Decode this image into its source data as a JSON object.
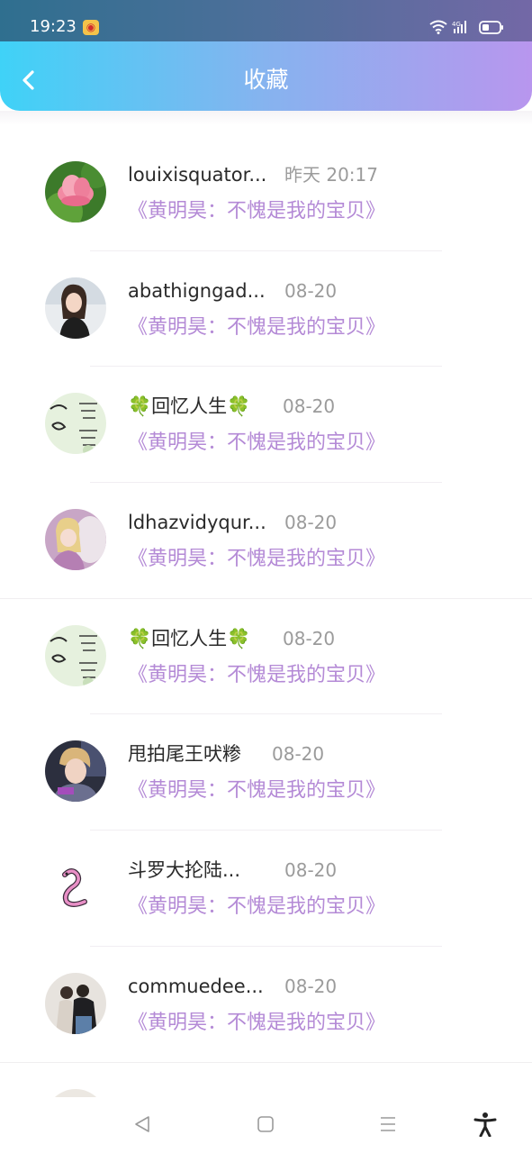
{
  "status_bar": {
    "time": "19:23",
    "app_notification_icon": "weibo-icon",
    "network": "4G"
  },
  "header": {
    "title": "收藏",
    "back_icon": "chevron-left-icon"
  },
  "favorites": [
    {
      "username": "louixisquator...",
      "time": "昨天 20:17",
      "content": "《黄明昊：不愧是我的宝贝》",
      "avatar": "lotus-flower-avatar"
    },
    {
      "username": "abathigngad...",
      "time": "08-20",
      "content": "《黄明昊：不愧是我的宝贝》",
      "avatar": "girl-photo-avatar"
    },
    {
      "username": "🍀回忆人生🍀",
      "time": "08-20",
      "content": "《黄明昊：不愧是我的宝贝》",
      "avatar": "calligraphy-avatar"
    },
    {
      "username": "ldhazvidyqur...",
      "time": "08-20",
      "content": "《黄明昊：不愧是我的宝贝》",
      "avatar": "girl-horse-avatar"
    },
    {
      "username": "🍀回忆人生🍀",
      "time": "08-20",
      "content": "《黄明昊：不愧是我的宝贝》",
      "avatar": "calligraphy-avatar"
    },
    {
      "username": "甩拍尾王吠糁",
      "time": "08-20",
      "content": "《黄明昊：不愧是我的宝贝》",
      "avatar": "boy-photo-avatar"
    },
    {
      "username": "斗罗大抡陆...",
      "time": "08-20",
      "content": "《黄明昊：不愧是我的宝贝》",
      "avatar": "pink-snake-avatar"
    },
    {
      "username": "commuedee...",
      "time": "08-20",
      "content": "《黄明昊：不愧是我的宝贝》",
      "avatar": "group-photo-avatar"
    },
    {
      "username": "",
      "time": "",
      "content": "",
      "avatar": "partial-avatar"
    }
  ],
  "system_nav": {
    "buttons": [
      "back-triangle-icon",
      "home-square-icon",
      "recents-menu-icon",
      "accessibility-icon"
    ]
  },
  "colors": {
    "header_gradient_start": "#3fd2f7",
    "header_gradient_end": "#b896ee",
    "content_link": "#b48ad6",
    "timestamp": "#9b9b9b"
  }
}
